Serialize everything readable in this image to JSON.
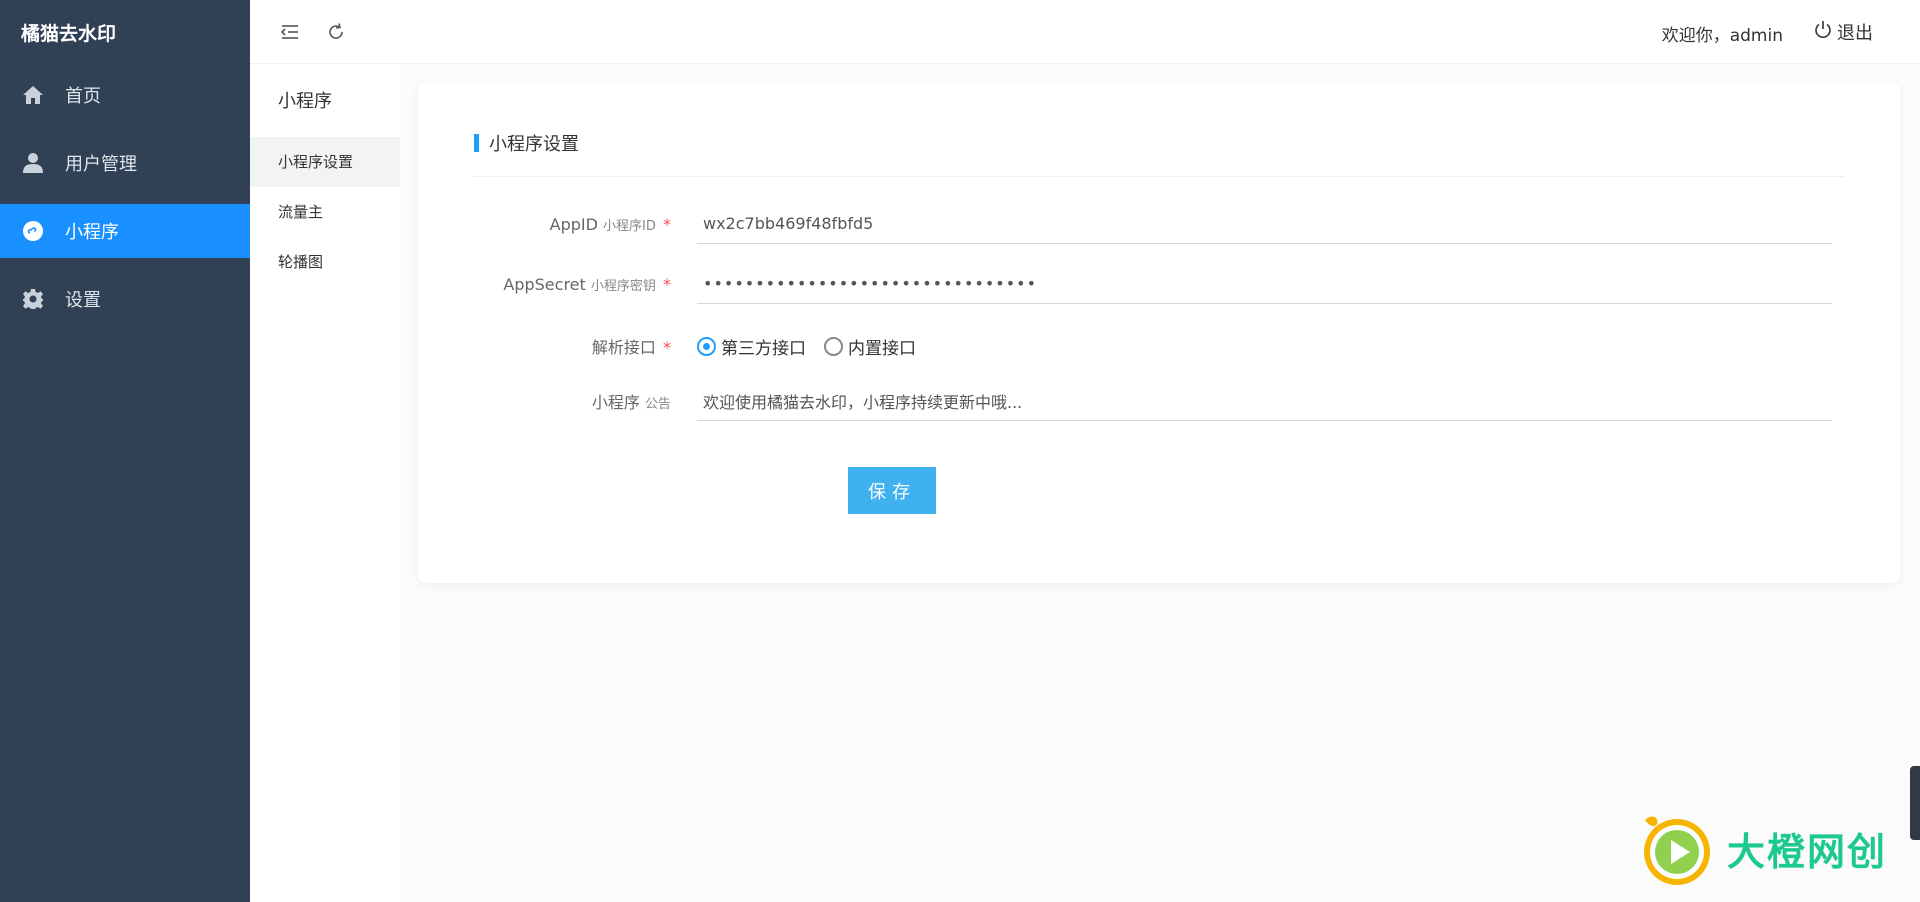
{
  "app": {
    "title": "橘猫去水印"
  },
  "sidebar": {
    "items": [
      {
        "label": "首页",
        "icon": "home-icon"
      },
      {
        "label": "用户管理",
        "icon": "user-icon"
      },
      {
        "label": "小程序",
        "icon": "miniprogram-icon"
      },
      {
        "label": "设置",
        "icon": "gear-icon"
      }
    ],
    "active_index": 2
  },
  "header": {
    "welcome": "欢迎你，admin",
    "logout_label": "退出"
  },
  "subnav": {
    "title": "小程序",
    "items": [
      {
        "label": "小程序设置"
      },
      {
        "label": "流量主"
      },
      {
        "label": "轮播图"
      }
    ],
    "active_index": 0
  },
  "card": {
    "title": "小程序设置",
    "form": {
      "appid": {
        "label": "AppID",
        "sub": "小程序ID",
        "required": "*",
        "value": "wx2c7bb469f48fbfd5"
      },
      "appsecret": {
        "label": "AppSecret",
        "sub": "小程序密钥",
        "required": "*",
        "value": "••••••••••••••••••••••••••••••••"
      },
      "api": {
        "label": "解析接口",
        "required": "*",
        "options": [
          "第三方接口",
          "内置接口"
        ],
        "selected": "第三方接口"
      },
      "notice": {
        "label": "小程序",
        "sub": "公告",
        "value": "欢迎使用橘猫去水印，小程序持续更新中哦..."
      }
    },
    "save_label": "保存"
  },
  "watermark": {
    "text": "大橙网创"
  },
  "colors": {
    "sidebar_bg": "#304156",
    "accent": "#1890ff",
    "button": "#3fb1f0",
    "watermark": "#1cc98f"
  }
}
